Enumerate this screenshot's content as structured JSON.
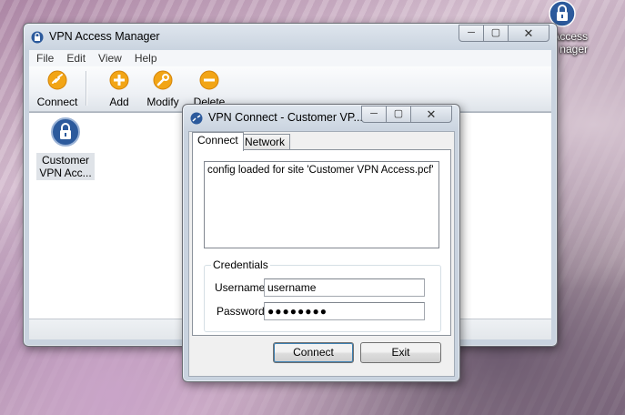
{
  "desktop": {
    "icon_label": "Access\nnager"
  },
  "main_window": {
    "title": "VPN Access Manager",
    "menu": [
      "File",
      "Edit",
      "View",
      "Help"
    ],
    "toolbar": {
      "connect": "Connect",
      "add": "Add",
      "modify": "Modify",
      "delete": "Delete"
    },
    "items": [
      {
        "label_line1": "Customer",
        "label_line2": "VPN Acc..."
      }
    ]
  },
  "dialog": {
    "title": "VPN Connect - Customer VP...",
    "tabs": [
      "Connect",
      "Network"
    ],
    "log_text": "config loaded for site 'Customer VPN Access.pcf'",
    "credentials_label": "Credentials",
    "username_label": "Username",
    "username_value": "username",
    "password_label": "Password",
    "password_value": "●●●●●●●●",
    "connect_button": "Connect",
    "exit_button": "Exit"
  },
  "colors": {
    "toolbar_icon_orange": "#f2a516",
    "lock_blue": "#2c5a9c"
  }
}
